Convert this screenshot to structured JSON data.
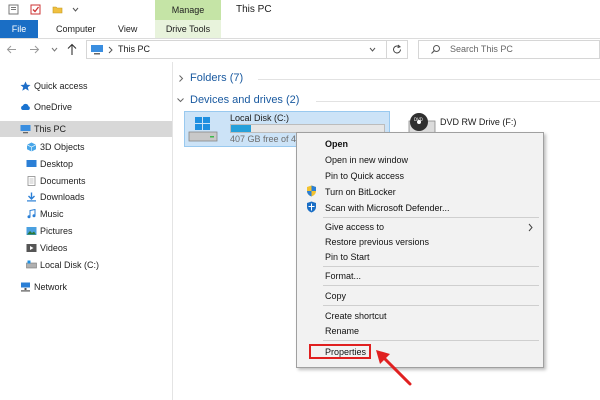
{
  "window": {
    "title": "This PC",
    "manage_tab": "Manage"
  },
  "ribbon": {
    "tabs": [
      "File",
      "Computer",
      "View",
      "Drive Tools"
    ]
  },
  "address": {
    "path": "This PC",
    "search_placeholder": "Search This PC"
  },
  "nav": {
    "items": [
      {
        "label": "Quick access",
        "icon": "star-icon",
        "color": "#1e6ec8"
      },
      {
        "label": "OneDrive",
        "icon": "cloud-icon",
        "color": "#1a73d0"
      },
      {
        "label": "This PC",
        "icon": "computer-icon",
        "color": "#3a8ee0"
      },
      {
        "label": "3D Objects",
        "icon": "cube-icon",
        "color": "#48a6e8"
      },
      {
        "label": "Desktop",
        "icon": "desktop-icon",
        "color": "#2b7fd6"
      },
      {
        "label": "Documents",
        "icon": "document-icon",
        "color": "#8c8c8c"
      },
      {
        "label": "Downloads",
        "icon": "download-icon",
        "color": "#2b7fd6"
      },
      {
        "label": "Music",
        "icon": "music-icon",
        "color": "#2b7fd6"
      },
      {
        "label": "Pictures",
        "icon": "picture-icon",
        "color": "#4aa0e0"
      },
      {
        "label": "Videos",
        "icon": "video-icon",
        "color": "#555555"
      },
      {
        "label": "Local Disk (C:)",
        "icon": "disk-icon",
        "color": "#777777"
      },
      {
        "label": "Network",
        "icon": "network-icon",
        "color": "#2b7fd6"
      }
    ]
  },
  "main": {
    "folders_header": "Folders (7)",
    "devices_header": "Devices and drives (2)",
    "drive_c": {
      "name": "Local Disk (C:)",
      "free": "407 GB free of 4",
      "used_fraction": 0.13
    },
    "drive_dvd": {
      "name": "DVD RW Drive (F:)"
    }
  },
  "context_menu": {
    "items": [
      "Open",
      "Open in new window",
      "Pin to Quick access",
      "Turn on BitLocker",
      "Scan with Microsoft Defender...",
      "Give access to",
      "Restore previous versions",
      "Pin to Start",
      "Format...",
      "Copy",
      "Create shortcut",
      "Rename",
      "Properties"
    ]
  },
  "colors": {
    "accent": "#1a6ec5",
    "selection": "#cce3f7",
    "highlight": "#e02020",
    "manage": "#c5e4a6"
  }
}
